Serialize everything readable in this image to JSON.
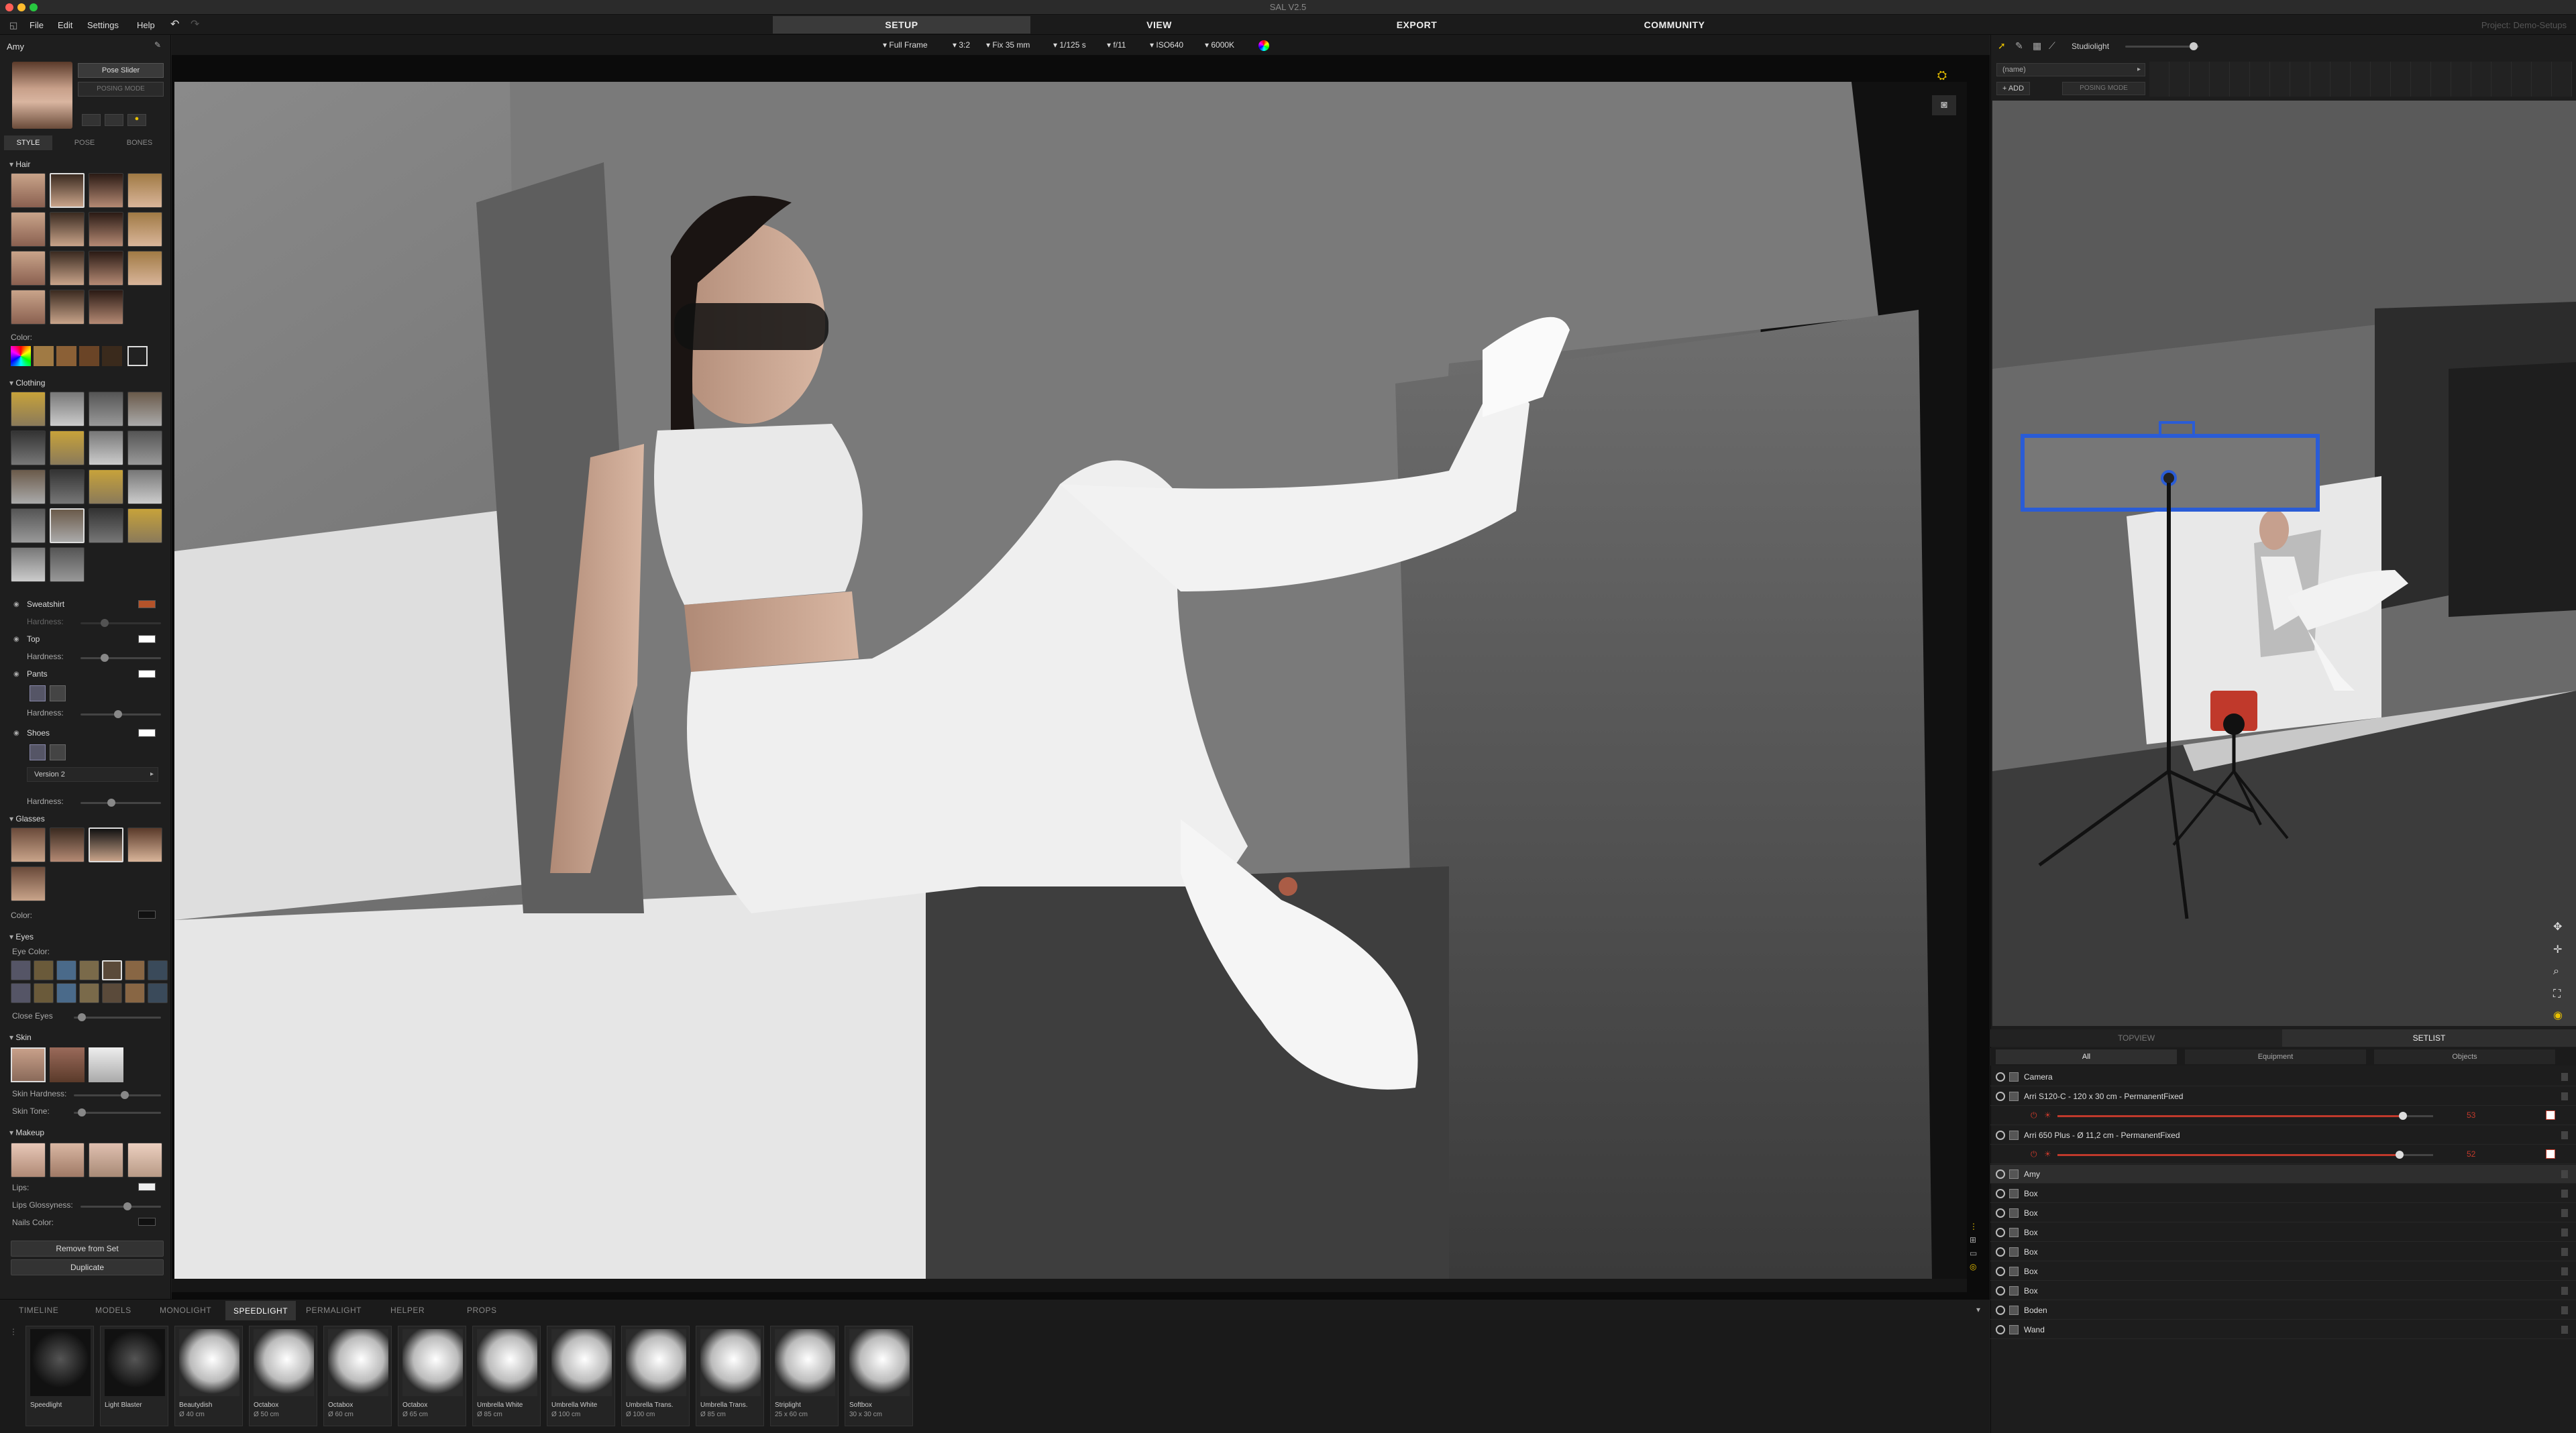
{
  "app": {
    "title": "SAL V2.5",
    "project": "Project: Demo-Setups"
  },
  "menu": {
    "file": "File",
    "edit": "Edit",
    "settings": "Settings",
    "help": "Help"
  },
  "modes": [
    "SETUP",
    "VIEW",
    "EXPORT",
    "COMMUNITY"
  ],
  "toolbar": {
    "sensor": "Full Frame",
    "ratio": "3:2",
    "lens": "Fix 35 mm",
    "shutter": "1/125 s",
    "aperture": "f/11",
    "iso": "ISO640",
    "kelvin": "6000K"
  },
  "left": {
    "model_name": "Amy",
    "pose_slider": "Pose Slider",
    "posing_mode": "POSING MODE",
    "tabs": [
      "STYLE",
      "POSE",
      "BONES"
    ],
    "sections": {
      "hair": "Hair",
      "color": "Color:",
      "clothing": "Clothing",
      "glasses": "Glasses",
      "eyes": "Eyes",
      "skin": "Skin",
      "makeup": "Makeup"
    },
    "clothing_items": {
      "sweatshirt": "Sweatshirt",
      "top": "Top",
      "pants": "Pants",
      "shoes": "Shoes",
      "hardness": "Hardness:",
      "version": "Version 2"
    },
    "eyes": {
      "eye_color": "Eye Color:",
      "close_eyes": "Close Eyes"
    },
    "skin": {
      "hardness": "Skin Hardness:",
      "tone": "Skin Tone:"
    },
    "makeup": {
      "lips": "Lips:",
      "glossy": "Lips Glossyness:",
      "nails": "Nails Color:"
    },
    "buttons": {
      "remove": "Remove from Set",
      "duplicate": "Duplicate"
    }
  },
  "right": {
    "tool_label": "Studiolight",
    "name_field": "(name)",
    "add": "ADD",
    "posing_mode": "POSING MODE",
    "tabs": {
      "topview": "TOPVIEW",
      "setlist": "SETLIST"
    },
    "filters": [
      "All",
      "Equipment",
      "Objects"
    ],
    "items": [
      {
        "name": "Camera"
      },
      {
        "name": "Arri S120-C - 120 x 30 cm - PermanentFixed",
        "power": "53",
        "level": 0.92
      },
      {
        "name": "Arri 650 Plus - Ø 11,2 cm - PermanentFixed",
        "power": "52",
        "level": 0.91
      },
      {
        "name": "Amy"
      },
      {
        "name": "Box"
      },
      {
        "name": "Box"
      },
      {
        "name": "Box"
      },
      {
        "name": "Box"
      },
      {
        "name": "Box"
      },
      {
        "name": "Box"
      },
      {
        "name": "Boden"
      },
      {
        "name": "Wand"
      }
    ]
  },
  "bottom": {
    "tabs": [
      "TIMELINE",
      "MODELS",
      "MONOLIGHT",
      "SPEEDLIGHT",
      "PERMALIGHT",
      "HELPER",
      "PROPS"
    ],
    "lights": [
      {
        "name": "Speedlight",
        "size": ""
      },
      {
        "name": "Light Blaster",
        "size": ""
      },
      {
        "name": "Beautydish",
        "size": "Ø 40 cm"
      },
      {
        "name": "Octabox",
        "size": "Ø 50 cm"
      },
      {
        "name": "Octabox",
        "size": "Ø 60 cm"
      },
      {
        "name": "Octabox",
        "size": "Ø 65 cm"
      },
      {
        "name": "Umbrella White",
        "size": "Ø 85 cm"
      },
      {
        "name": "Umbrella White",
        "size": "Ø 100 cm"
      },
      {
        "name": "Umbrella Trans.",
        "size": "Ø 100 cm"
      },
      {
        "name": "Umbrella Trans.",
        "size": "Ø 85 cm"
      },
      {
        "name": "Striplight",
        "size": "25 x 60 cm"
      },
      {
        "name": "Softbox",
        "size": "30 x 30 cm"
      }
    ]
  },
  "colors": {
    "accent_red": "#c0392b",
    "selection_blue": "#2a5cd6",
    "swatch_orange": "#b4532a"
  }
}
